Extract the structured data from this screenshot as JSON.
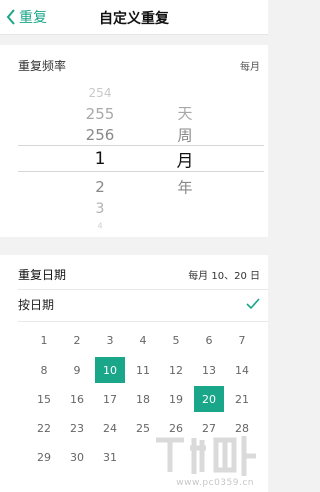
{
  "header": {
    "back_label": "重复",
    "title": "自定义重复"
  },
  "frequency": {
    "label": "重复频率",
    "value": "每月"
  },
  "picker": {
    "numbers": [
      "254",
      "255",
      "256",
      "1",
      "2",
      "3",
      "4"
    ],
    "units": [
      "天",
      "周",
      "月",
      "年"
    ],
    "selected_number": "1",
    "selected_unit": "月"
  },
  "repeat_date": {
    "label": "重复日期",
    "value": "每月 10、20 日",
    "by_date_label": "按日期"
  },
  "calendar": {
    "days": [
      "1",
      "2",
      "3",
      "4",
      "5",
      "6",
      "7",
      "8",
      "9",
      "10",
      "11",
      "12",
      "13",
      "14",
      "15",
      "16",
      "17",
      "18",
      "19",
      "20",
      "21",
      "22",
      "23",
      "24",
      "25",
      "26",
      "27",
      "28",
      "29",
      "30",
      "31"
    ],
    "selected": [
      "10",
      "20"
    ]
  },
  "colors": {
    "accent": "#1aa689",
    "background": "#f2f2f2"
  },
  "watermark": {
    "text": "www.pc0359.cn"
  }
}
